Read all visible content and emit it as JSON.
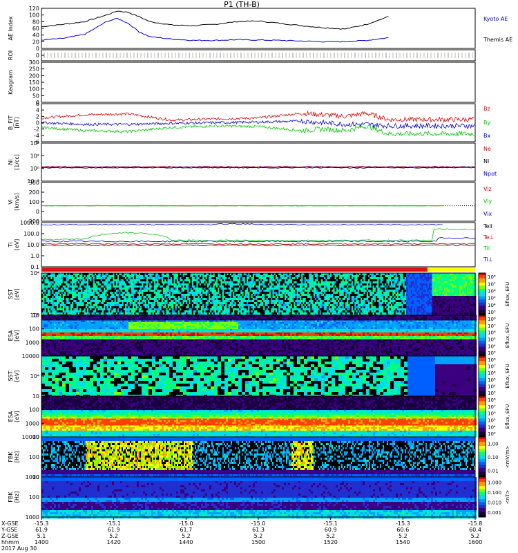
{
  "title": "P1 (TH-B)",
  "colors": {
    "red": "#e00000",
    "green": "#00c800",
    "blue": "#0000d0",
    "black": "#000000",
    "bar_red": "#e01010",
    "bar_yellow": "#ffff00"
  },
  "chart_data": [
    {
      "type": "line",
      "panel": "ae",
      "ylabel": "AE Index",
      "ylim": [
        0,
        120
      ],
      "yticks": [
        "0",
        "20",
        "40",
        "60",
        "80",
        "100",
        "120"
      ],
      "series": [
        {
          "name": "Kyoto AE",
          "color": "#0000d0",
          "x": [
            1400,
            1410,
            1420,
            1430,
            1435,
            1440,
            1445,
            1450,
            1460,
            1470,
            1480,
            1490,
            1500,
            1510,
            1520,
            1530,
            1540,
            1550,
            1560
          ],
          "y": [
            65,
            72,
            80,
            100,
            112,
            108,
            95,
            80,
            70,
            68,
            72,
            80,
            82,
            75,
            68,
            62,
            58,
            72,
            95
          ]
        },
        {
          "name": "Themis AE",
          "color": "#0000d0",
          "x": [
            1400,
            1410,
            1420,
            1430,
            1435,
            1440,
            1445,
            1450,
            1460,
            1470,
            1480,
            1490,
            1500,
            1510,
            1520,
            1530,
            1540,
            1550,
            1560
          ],
          "y": [
            25,
            30,
            42,
            80,
            90,
            75,
            50,
            35,
            28,
            24,
            24,
            26,
            25,
            24,
            22,
            20,
            20,
            24,
            32
          ]
        }
      ]
    },
    {
      "type": "line",
      "panel": "roi",
      "ylabel": "ROI",
      "ylim": [
        0,
        1
      ],
      "yticks": [
        "0"
      ]
    },
    {
      "type": "line",
      "panel": "keogram",
      "ylabel": "Keogram",
      "ylim": [
        0,
        300
      ],
      "yticks": [
        "0",
        "50",
        "100",
        "150",
        "200",
        "250",
        "300"
      ]
    },
    {
      "type": "line",
      "panel": "bfield",
      "ylabel": "B_FIT",
      "unit": "[nT]",
      "ylim": [
        -6,
        6
      ],
      "yticks": [
        "-6",
        "-4",
        "-2",
        "0",
        "2",
        "4",
        "6"
      ],
      "series": [
        {
          "name": "Bz",
          "color": "#e00000",
          "x": [
            1400,
            1420,
            1440,
            1460,
            1480,
            1500,
            1520,
            1530,
            1540,
            1550,
            1560
          ],
          "y": [
            1.5,
            2.5,
            2.8,
            0.8,
            1.2,
            1.5,
            3.0,
            2.5,
            2.0,
            3.0,
            1.0
          ]
        },
        {
          "name": "By",
          "color": "#00c800",
          "x": [
            1400,
            1420,
            1440,
            1460,
            1480,
            1500,
            1520,
            1530,
            1540,
            1550,
            1560
          ],
          "y": [
            -1.5,
            -2.5,
            -2.8,
            -1.5,
            -1.0,
            -1.2,
            -2.5,
            -2.0,
            -2.5,
            -1.0,
            -3.5
          ]
        },
        {
          "name": "Bx",
          "color": "#0000d0",
          "x": [
            1400,
            1420,
            1440,
            1460,
            1480,
            1500,
            1520,
            1530,
            1540,
            1550,
            1560
          ],
          "y": [
            0.0,
            -0.5,
            -0.5,
            -0.2,
            0.0,
            0.2,
            0.5,
            0.0,
            -0.5,
            -0.5,
            -1.0
          ]
        }
      ]
    },
    {
      "type": "line",
      "panel": "density",
      "ylabel": "Ni",
      "unit": "[1/cc]",
      "yticks": [
        "10⁻³",
        "10⁰",
        "10²",
        "10⁴"
      ],
      "legend": [
        "Ne",
        "Nl",
        "Npot"
      ]
    },
    {
      "type": "line",
      "panel": "velocity",
      "ylabel": "Vi",
      "unit": "[km/s]",
      "ylim": [
        -200,
        300
      ],
      "yticks": [
        "-200",
        "0",
        "100",
        "200",
        "300"
      ],
      "legend": [
        "Viz",
        "Viy",
        "Vix"
      ]
    },
    {
      "type": "line",
      "panel": "temperature",
      "ylabel": "Ti",
      "unit": "[eV]",
      "yticks": [
        "0.1",
        "1.0",
        "10.0",
        "100.0",
        "1000.0"
      ],
      "legend": [
        "Tell",
        "Te⊥",
        "Til",
        "Ti⊥"
      ]
    },
    {
      "type": "heatmap",
      "panel": "sst-e",
      "ylabel": "SST",
      "unit": "[eV]",
      "yticks": [
        "10⁶",
        "10⁴"
      ],
      "colorbar": "Eflux, EFU",
      "cticks": [
        "10⁸",
        "10⁷",
        "10⁶",
        "10⁵",
        "10⁴",
        "10³"
      ]
    },
    {
      "type": "heatmap",
      "panel": "esa-e",
      "ylabel": "ESA",
      "unit": "[eV]",
      "yticks": [
        "10000",
        "1000",
        "100",
        "10"
      ],
      "colorbar": "Eflux, EFU",
      "cticks": [
        "10⁸",
        "10⁷",
        "10⁶",
        "10⁵",
        "10⁴",
        "10³"
      ]
    },
    {
      "type": "heatmap",
      "panel": "sst-i",
      "ylabel": "SST",
      "unit": "[eV]",
      "yticks": [
        "10⁴"
      ],
      "colorbar": "Eflux, EFU",
      "cticks": [
        "10⁸",
        "10⁷",
        "10⁶",
        "10⁵",
        "10⁴",
        "10³"
      ]
    },
    {
      "type": "heatmap",
      "panel": "esa-i",
      "ylabel": "ESA",
      "unit": "[eV]",
      "yticks": [
        "10000",
        "1000",
        "100",
        "10"
      ],
      "colorbar": "Eflux, EFU",
      "cticks": [
        "10⁸",
        "10⁷",
        "10⁶",
        "10⁵",
        "10⁴",
        "10³"
      ]
    },
    {
      "type": "heatmap",
      "panel": "fbk-e",
      "ylabel": "FBK",
      "unit": "[Hz]",
      "yticks": [
        "1000",
        "100",
        "10"
      ],
      "colorbar": "<mV/m>",
      "cticks": [
        "1.00",
        "0.10",
        "0.01"
      ]
    },
    {
      "type": "heatmap",
      "panel": "fbk-b",
      "ylabel": "FBK",
      "unit": "[Hz]",
      "yticks": [
        "1000",
        "100",
        "10"
      ],
      "colorbar": "<nT>",
      "cticks": [
        "1.000",
        "0.100",
        "0.010",
        "0.001"
      ]
    }
  ],
  "xaxis": {
    "labels": [
      "X-GSE",
      "Y-GSE",
      "Z-GSE",
      "hhmm"
    ],
    "date": "2017 Aug 30",
    "ticks": [
      {
        "x": "-15.3",
        "y": "61.9",
        "z": "5.1",
        "t": "1400"
      },
      {
        "x": "-15.1",
        "y": "61.9",
        "z": "5.2",
        "t": "1420"
      },
      {
        "x": "-15.0",
        "y": "61.7",
        "z": "5.2",
        "t": "1440"
      },
      {
        "x": "-15.0",
        "y": "61.3",
        "z": "5.2",
        "t": "1500"
      },
      {
        "x": "-15.1",
        "y": "60.9",
        "z": "5.2",
        "t": "1520"
      },
      {
        "x": "-15.3",
        "y": "60.6",
        "z": "5.2",
        "t": "1540"
      },
      {
        "x": "-15.8",
        "y": "60.4",
        "z": "5.2",
        "t": "1600"
      }
    ]
  },
  "legends": {
    "ae": [
      "Kyoto AE",
      "Themis AE"
    ],
    "b": [
      "Bz",
      "By",
      "Bx"
    ]
  }
}
